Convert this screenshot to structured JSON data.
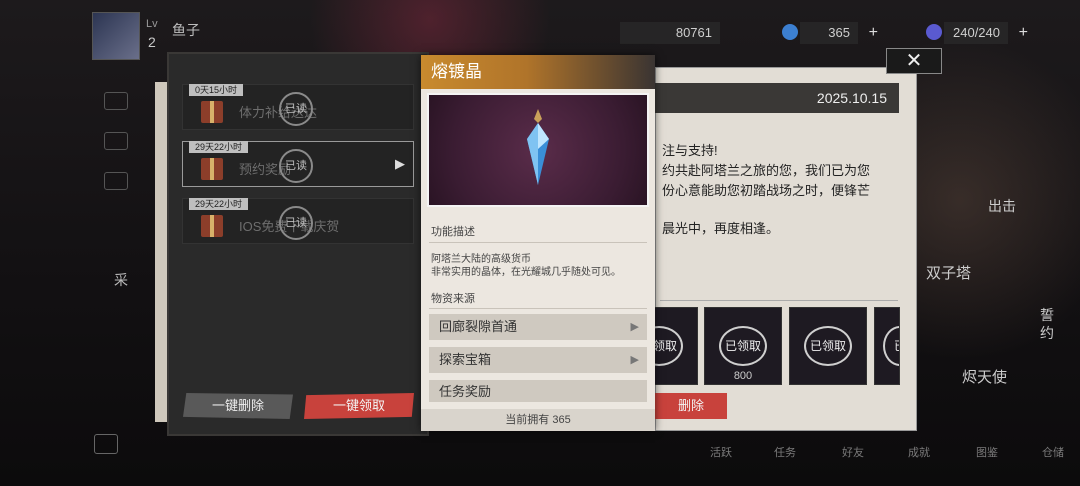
{
  "player": {
    "level_label": "Lv",
    "level": "2",
    "name": "鱼子"
  },
  "resources": [
    {
      "name": "gold",
      "value": "80761",
      "icon": "gold-coin-icon"
    },
    {
      "name": "crystal",
      "value": "365",
      "icon": "crystal-icon"
    },
    {
      "name": "stamina",
      "value": "240/240",
      "icon": "stamina-icon"
    }
  ],
  "mail_list": [
    {
      "time": "0天15小时",
      "title": "体力补给送达",
      "stamp": "已读",
      "active": false
    },
    {
      "time": "29天22小时",
      "title": "预约奖励",
      "stamp": "已读",
      "active": true
    },
    {
      "time": "29天22小时",
      "title": "IOS免费下载庆贺",
      "stamp": "已读",
      "active": false
    }
  ],
  "buttons": {
    "delete_all": "一键删除",
    "claim_all": "一键领取",
    "delete": "删除"
  },
  "letter": {
    "date": "2025.10.15",
    "lines": [
      "注与支持!",
      "约共赴阿塔兰之旅的您，我们已为您",
      "份心意能助您初踏战场之时，便锋芒",
      "晨光中，再度相逢。"
    ]
  },
  "rewards": [
    {
      "status": "已领取",
      "amount": ""
    },
    {
      "status": "已领取",
      "amount": "800"
    },
    {
      "status": "已领取",
      "amount": ""
    },
    {
      "status": "已",
      "amount": ""
    }
  ],
  "item_popup": {
    "title": "熔镀晶",
    "desc_heading": "功能描述",
    "desc_lines": [
      "阿塔兰大陆的高级货币",
      "非常实用的晶体，在光耀城几乎随处可见。"
    ],
    "source_heading": "物资来源",
    "sources": [
      "回廊裂隙首通",
      "探索宝箱",
      "任务奖励"
    ],
    "owned": "当前拥有 365"
  },
  "close_label": "✕",
  "side_labels": {
    "left_menu": "采",
    "right_tag": "出击",
    "tower": "双子塔",
    "oath": "誓约",
    "angel": "烬天使"
  },
  "bottom_nav": [
    "活跃",
    "任务",
    "好友",
    "成就",
    "图鉴",
    "仓储"
  ]
}
